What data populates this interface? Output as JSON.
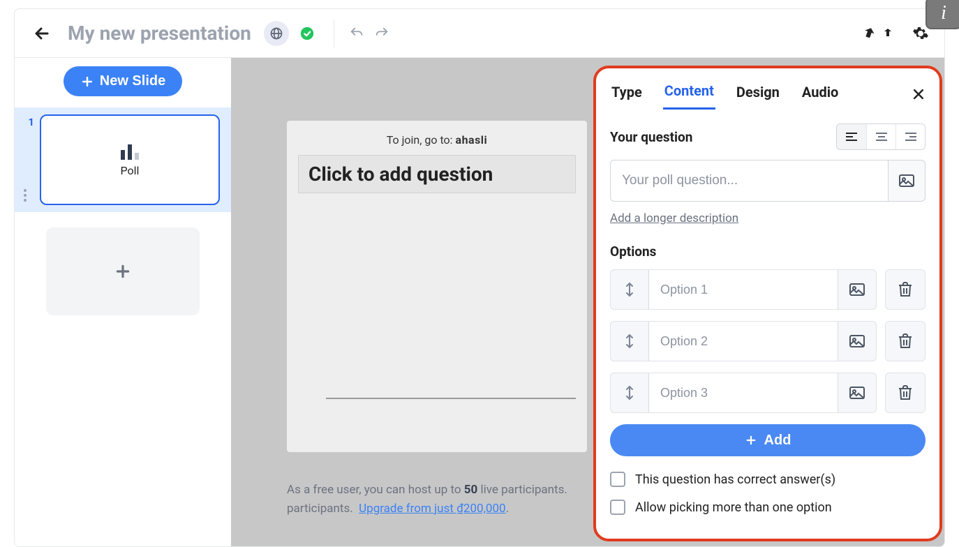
{
  "header": {
    "title": "My new presentation"
  },
  "sidebar": {
    "new_slide_label": "New Slide",
    "slides": [
      {
        "number": "1",
        "label": "Poll"
      }
    ]
  },
  "canvas": {
    "join_prefix": "To join, go to: ",
    "join_domain": "ahasli",
    "question_placeholder": "Click to add question"
  },
  "footer": {
    "line1_pre": "As a free user, you can host up to ",
    "line1_bold": "50",
    "line1_post": " live participants.  ",
    "upgrade_text": "Upgrade from just ",
    "upgrade_price": "₫200,000",
    "period": "."
  },
  "panel": {
    "tabs": {
      "type": "Type",
      "content": "Content",
      "design": "Design",
      "audio": "Audio"
    },
    "section_question_label": "Your question",
    "question_placeholder": "Your poll question...",
    "desc_link": "Add a longer description",
    "options_label": "Options",
    "options": [
      {
        "placeholder": "Option 1"
      },
      {
        "placeholder": "Option 2"
      },
      {
        "placeholder": "Option 3"
      }
    ],
    "add_label": "Add",
    "check_correct": "This question has correct answer(s)",
    "check_multi": "Allow picking more than one option"
  },
  "info_badge": "i"
}
